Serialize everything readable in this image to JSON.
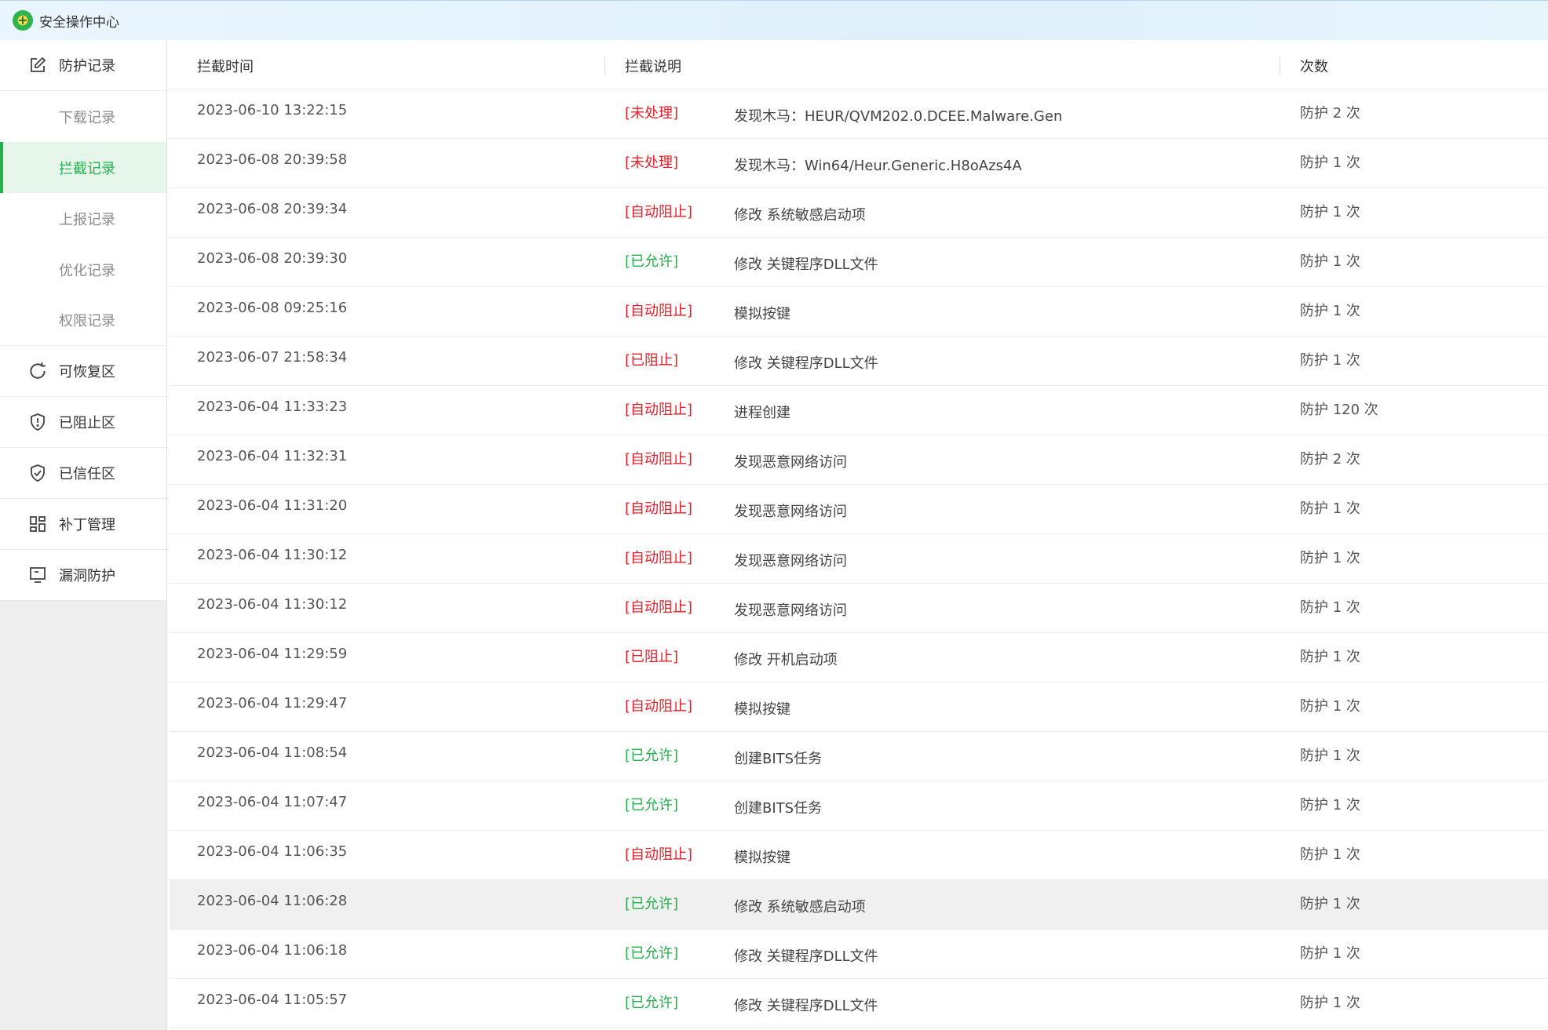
{
  "window": {
    "title": "安全操作中心"
  },
  "sidebar": {
    "items": [
      {
        "label": "防护记录",
        "icon": "edit-icon",
        "type": "group"
      },
      {
        "label": "下载记录",
        "type": "sub"
      },
      {
        "label": "拦截记录",
        "type": "sub",
        "active": true
      },
      {
        "label": "上报记录",
        "type": "sub"
      },
      {
        "label": "优化记录",
        "type": "sub"
      },
      {
        "label": "权限记录",
        "type": "sub"
      },
      {
        "label": "可恢复区",
        "icon": "restore-icon",
        "type": "group"
      },
      {
        "label": "已阻止区",
        "icon": "shield-alert-icon",
        "type": "group"
      },
      {
        "label": "已信任区",
        "icon": "shield-check-icon",
        "type": "group"
      },
      {
        "label": "补丁管理",
        "icon": "grid-icon",
        "type": "group"
      },
      {
        "label": "漏洞防护",
        "icon": "monitor-icon",
        "type": "group"
      }
    ]
  },
  "table": {
    "headers": {
      "time": "拦截时间",
      "desc": "拦截说明",
      "count": "次数"
    },
    "rows": [
      {
        "time": "2023-06-10 13:22:15",
        "status": "[未处理]",
        "status_color": "red",
        "desc": "发现木马：HEUR/QVM202.0.DCEE.Malware.Gen",
        "count": "防护 2 次"
      },
      {
        "time": "2023-06-08 20:39:58",
        "status": "[未处理]",
        "status_color": "red",
        "desc": "发现木马：Win64/Heur.Generic.H8oAzs4A",
        "count": "防护 1 次"
      },
      {
        "time": "2023-06-08 20:39:34",
        "status": "[自动阻止]",
        "status_color": "red",
        "desc": "修改 系统敏感启动项",
        "count": "防护 1 次"
      },
      {
        "time": "2023-06-08 20:39:30",
        "status": "[已允许]",
        "status_color": "green",
        "desc": "修改 关键程序DLL文件",
        "count": "防护 1 次"
      },
      {
        "time": "2023-06-08 09:25:16",
        "status": "[自动阻止]",
        "status_color": "red",
        "desc": "模拟按键",
        "count": "防护 1 次"
      },
      {
        "time": "2023-06-07 21:58:34",
        "status": "[已阻止]",
        "status_color": "red",
        "desc": "修改 关键程序DLL文件",
        "count": "防护 1 次"
      },
      {
        "time": "2023-06-04 11:33:23",
        "status": "[自动阻止]",
        "status_color": "red",
        "desc": "进程创建",
        "count": "防护 120 次"
      },
      {
        "time": "2023-06-04 11:32:31",
        "status": "[自动阻止]",
        "status_color": "red",
        "desc": "发现恶意网络访问",
        "count": "防护 2 次"
      },
      {
        "time": "2023-06-04 11:31:20",
        "status": "[自动阻止]",
        "status_color": "red",
        "desc": "发现恶意网络访问",
        "count": "防护 1 次"
      },
      {
        "time": "2023-06-04 11:30:12",
        "status": "[自动阻止]",
        "status_color": "red",
        "desc": "发现恶意网络访问",
        "count": "防护 1 次"
      },
      {
        "time": "2023-06-04 11:30:12",
        "status": "[自动阻止]",
        "status_color": "red",
        "desc": "发现恶意网络访问",
        "count": "防护 1 次"
      },
      {
        "time": "2023-06-04 11:29:59",
        "status": "[已阻止]",
        "status_color": "red",
        "desc": "修改 开机启动项",
        "count": "防护 1 次"
      },
      {
        "time": "2023-06-04 11:29:47",
        "status": "[自动阻止]",
        "status_color": "red",
        "desc": "模拟按键",
        "count": "防护 1 次"
      },
      {
        "time": "2023-06-04 11:08:54",
        "status": "[已允许]",
        "status_color": "green",
        "desc": "创建BITS任务",
        "count": "防护 1 次"
      },
      {
        "time": "2023-06-04 11:07:47",
        "status": "[已允许]",
        "status_color": "green",
        "desc": "创建BITS任务",
        "count": "防护 1 次"
      },
      {
        "time": "2023-06-04 11:06:35",
        "status": "[自动阻止]",
        "status_color": "red",
        "desc": "模拟按键",
        "count": "防护 1 次"
      },
      {
        "time": "2023-06-04 11:06:28",
        "status": "[已允许]",
        "status_color": "green",
        "desc": "修改 系统敏感启动项",
        "count": "防护 1 次",
        "hover": true
      },
      {
        "time": "2023-06-04 11:06:18",
        "status": "[已允许]",
        "status_color": "green",
        "desc": "修改 关键程序DLL文件",
        "count": "防护 1 次"
      },
      {
        "time": "2023-06-04 11:05:57",
        "status": "[已允许]",
        "status_color": "green",
        "desc": "修改 关键程序DLL文件",
        "count": "防护 1 次"
      }
    ]
  },
  "colors": {
    "accent": "#22b14c",
    "danger": "#e6202a",
    "active_bg": "#e6f6ea"
  }
}
